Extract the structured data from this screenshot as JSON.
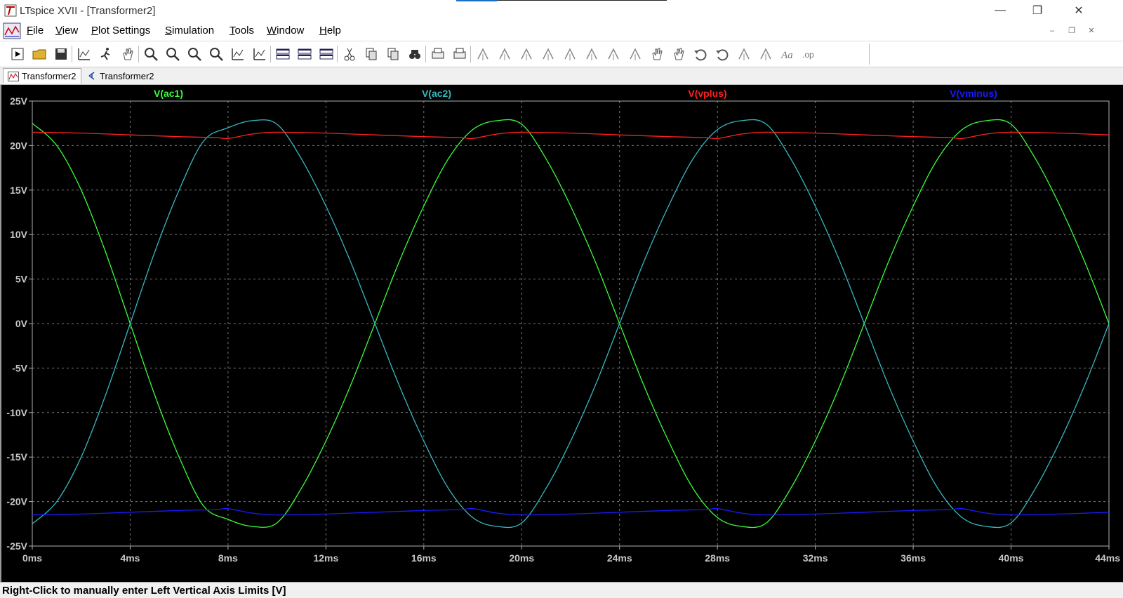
{
  "window": {
    "title": "LTspice XVII - [Transformer2]"
  },
  "menu": [
    {
      "key": "file",
      "label": "File",
      "u": "F",
      "rest": "ile"
    },
    {
      "key": "view",
      "label": "View",
      "u": "V",
      "rest": "iew"
    },
    {
      "key": "plot-settings",
      "label": "Plot Settings",
      "u": "P",
      "rest": "lot Settings"
    },
    {
      "key": "simulation",
      "label": "Simulation",
      "u": "S",
      "rest": "imulation"
    },
    {
      "key": "tools",
      "label": "Tools",
      "u": "T",
      "rest": "ools"
    },
    {
      "key": "window",
      "label": "Window",
      "u": "W",
      "rest": "indow"
    },
    {
      "key": "help",
      "label": "Help",
      "u": "H",
      "rest": "elp"
    }
  ],
  "toolbar_icons": [
    "open-schematic-icon",
    "open-folder-icon",
    "save-icon",
    "control-panel-icon",
    "run-icon",
    "halt-icon",
    "zoom-in-icon",
    "zoom-fit-icon",
    "zoom-out-icon",
    "zoom-cancel-icon",
    "autorange-icon",
    "manual-limits-icon",
    "tile-horizontal-icon",
    "cascade-icon",
    "tile-vertical-icon",
    "cut-icon",
    "copy-icon",
    "paste-icon",
    "find-icon",
    "print-icon",
    "print-setup-icon",
    "wire-icon",
    "ground-icon",
    "label-net-icon",
    "resistor-icon",
    "capacitor-icon",
    "inductor-icon",
    "diode-icon",
    "component-icon",
    "move-icon",
    "drag-icon",
    "undo-icon",
    "redo-icon",
    "rotate-icon",
    "mirror-icon",
    "text-icon",
    "spice-directive-icon"
  ],
  "tabs": [
    {
      "label": "Transformer2",
      "icon": "waveform-icon",
      "active": true
    },
    {
      "label": "Transformer2",
      "icon": "schematic-icon",
      "active": false
    }
  ],
  "status": {
    "message": "Right-Click to manually enter Left Vertical Axis Limits [V]"
  },
  "chart_data": {
    "type": "line",
    "xlabel": "",
    "ylabel": "",
    "x_unit": "ms",
    "y_unit": "V",
    "xlim": [
      0,
      44
    ],
    "ylim": [
      -25,
      25
    ],
    "x_ticks": [
      0,
      4,
      8,
      12,
      16,
      20,
      24,
      28,
      32,
      36,
      40,
      44
    ],
    "y_ticks": [
      -25,
      -20,
      -15,
      -10,
      -5,
      0,
      5,
      10,
      15,
      20,
      25
    ],
    "x_tick_labels": [
      "0ms",
      "4ms",
      "8ms",
      "12ms",
      "16ms",
      "20ms",
      "24ms",
      "28ms",
      "32ms",
      "36ms",
      "40ms",
      "44ms"
    ],
    "y_tick_labels": [
      "-25V",
      "-20V",
      "-15V",
      "-10V",
      "-5V",
      "0V",
      "5V",
      "10V",
      "15V",
      "20V",
      "25V"
    ],
    "grid": true,
    "background": "#000000",
    "series": [
      {
        "name": "V(ac1)",
        "color": "#39ff39",
        "points": [
          [
            0,
            22.5
          ],
          [
            1,
            20
          ],
          [
            2,
            15
          ],
          [
            3,
            8
          ],
          [
            4,
            0
          ],
          [
            5,
            -8
          ],
          [
            6,
            -15
          ],
          [
            7,
            -20.5
          ],
          [
            8,
            -22
          ],
          [
            9,
            -22.8
          ],
          [
            10,
            -22.4
          ],
          [
            11,
            -18.5
          ],
          [
            12,
            -13.2
          ],
          [
            13,
            -7
          ],
          [
            14,
            0
          ],
          [
            15,
            7
          ],
          [
            16,
            13.2
          ],
          [
            17,
            18.5
          ],
          [
            18,
            21.8
          ],
          [
            19,
            22.8
          ],
          [
            20,
            22.4
          ],
          [
            21,
            18.5
          ],
          [
            22,
            13.2
          ],
          [
            23,
            7
          ],
          [
            24,
            0
          ],
          [
            25,
            -7
          ],
          [
            26,
            -13.2
          ],
          [
            27,
            -18.5
          ],
          [
            28,
            -21.8
          ],
          [
            29,
            -22.8
          ],
          [
            30,
            -22.4
          ],
          [
            31,
            -18.5
          ],
          [
            32,
            -13.2
          ],
          [
            33,
            -7
          ],
          [
            34,
            0
          ],
          [
            35,
            7
          ],
          [
            36,
            13.2
          ],
          [
            37,
            18.5
          ],
          [
            38,
            21.8
          ],
          [
            39,
            22.8
          ],
          [
            40,
            22.4
          ],
          [
            41,
            18.5
          ],
          [
            42,
            13.2
          ],
          [
            43,
            7
          ],
          [
            44,
            0
          ]
        ]
      },
      {
        "name": "V(ac2)",
        "color": "#36b8c0",
        "points": [
          [
            0,
            -22.5
          ],
          [
            1,
            -20
          ],
          [
            2,
            -15
          ],
          [
            3,
            -8
          ],
          [
            4,
            0
          ],
          [
            5,
            8
          ],
          [
            6,
            15
          ],
          [
            7,
            20.5
          ],
          [
            8,
            22
          ],
          [
            9,
            22.8
          ],
          [
            10,
            22.4
          ],
          [
            11,
            18.5
          ],
          [
            12,
            13.2
          ],
          [
            13,
            7
          ],
          [
            14,
            0
          ],
          [
            15,
            -7
          ],
          [
            16,
            -13.2
          ],
          [
            17,
            -18.5
          ],
          [
            18,
            -21.8
          ],
          [
            19,
            -22.8
          ],
          [
            20,
            -22.4
          ],
          [
            21,
            -18.5
          ],
          [
            22,
            -13.2
          ],
          [
            23,
            -7
          ],
          [
            24,
            0
          ],
          [
            25,
            7
          ],
          [
            26,
            13.2
          ],
          [
            27,
            18.5
          ],
          [
            28,
            21.8
          ],
          [
            29,
            22.8
          ],
          [
            30,
            22.4
          ],
          [
            31,
            18.5
          ],
          [
            32,
            13.2
          ],
          [
            33,
            7
          ],
          [
            34,
            0
          ],
          [
            35,
            -7
          ],
          [
            36,
            -13.2
          ],
          [
            37,
            -18.5
          ],
          [
            38,
            -21.8
          ],
          [
            39,
            -22.8
          ],
          [
            40,
            -22.4
          ],
          [
            41,
            -18.5
          ],
          [
            42,
            -13.2
          ],
          [
            43,
            -7
          ],
          [
            44,
            0
          ]
        ]
      },
      {
        "name": "V(vplus)",
        "color": "#ff2020",
        "points": [
          [
            0,
            21.5
          ],
          [
            2,
            21.4
          ],
          [
            4,
            21.2
          ],
          [
            6,
            21.0
          ],
          [
            7.5,
            20.9
          ],
          [
            8,
            20.8
          ],
          [
            9,
            21.3
          ],
          [
            10,
            21.5
          ],
          [
            12,
            21.4
          ],
          [
            14,
            21.2
          ],
          [
            16,
            21.0
          ],
          [
            17.5,
            20.9
          ],
          [
            18,
            20.8
          ],
          [
            19,
            21.3
          ],
          [
            20,
            21.5
          ],
          [
            22,
            21.4
          ],
          [
            24,
            21.2
          ],
          [
            26,
            21.0
          ],
          [
            27.5,
            20.9
          ],
          [
            28,
            20.8
          ],
          [
            29,
            21.3
          ],
          [
            30,
            21.5
          ],
          [
            32,
            21.4
          ],
          [
            34,
            21.2
          ],
          [
            36,
            21.0
          ],
          [
            37.5,
            20.9
          ],
          [
            38,
            20.8
          ],
          [
            39,
            21.3
          ],
          [
            40,
            21.5
          ],
          [
            42,
            21.4
          ],
          [
            44,
            21.2
          ]
        ]
      },
      {
        "name": "V(vminus)",
        "color": "#1a1aff",
        "points": [
          [
            0,
            -21.5
          ],
          [
            2,
            -21.4
          ],
          [
            4,
            -21.2
          ],
          [
            6,
            -21.0
          ],
          [
            7.5,
            -20.9
          ],
          [
            8,
            -20.8
          ],
          [
            9,
            -21.3
          ],
          [
            10,
            -21.5
          ],
          [
            12,
            -21.4
          ],
          [
            14,
            -21.2
          ],
          [
            16,
            -21.0
          ],
          [
            17.5,
            -20.9
          ],
          [
            18,
            -20.8
          ],
          [
            19,
            -21.3
          ],
          [
            20,
            -21.5
          ],
          [
            22,
            -21.4
          ],
          [
            24,
            -21.2
          ],
          [
            26,
            -21.0
          ],
          [
            27.5,
            -20.9
          ],
          [
            28,
            -20.8
          ],
          [
            29,
            -21.3
          ],
          [
            30,
            -21.5
          ],
          [
            32,
            -21.4
          ],
          [
            34,
            -21.2
          ],
          [
            36,
            -21.0
          ],
          [
            37.5,
            -20.9
          ],
          [
            38,
            -20.8
          ],
          [
            39,
            -21.3
          ],
          [
            40,
            -21.5
          ],
          [
            42,
            -21.4
          ],
          [
            44,
            -21.2
          ]
        ]
      }
    ]
  }
}
